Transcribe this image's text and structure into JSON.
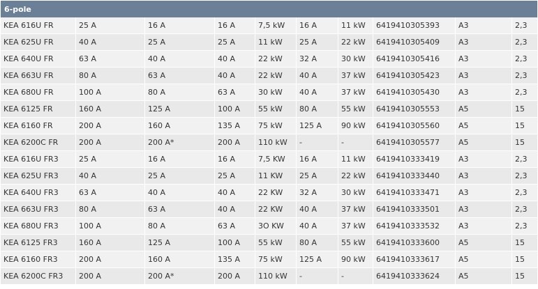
{
  "table": {
    "header": "6-pole",
    "rows": [
      [
        "KEA 616U FR",
        "25 A",
        "16 A",
        "16 A",
        "7,5 kW",
        "16 A",
        "11 kW",
        "6419410305393",
        "A3",
        "2,3"
      ],
      [
        "KEA 625U FR",
        "40 A",
        "25 A",
        "25 A",
        "11 kW",
        "25 A",
        "22 kW",
        "6419410305409",
        "A3",
        "2,3"
      ],
      [
        "KEA 640U FR",
        "63 A",
        "40 A",
        "40 A",
        "22 kW",
        "32 A",
        "30 kW",
        "6419410305416",
        "A3",
        "2,3"
      ],
      [
        "KEA 663U FR",
        "80 A",
        "63 A",
        "40 A",
        "22 kW",
        "40 A",
        "37 kW",
        "6419410305423",
        "A3",
        "2,3"
      ],
      [
        "KEA 680U FR",
        "100 A",
        "80 A",
        "63 A",
        "30 kW",
        "40 A",
        "37 kW",
        "6419410305430",
        "A3",
        "2,3"
      ],
      [
        "KEA 6125 FR",
        "160 A",
        "125 A",
        "100 A",
        "55 kW",
        "80 A",
        "55 kW",
        "6419410305553",
        "A5",
        "15"
      ],
      [
        "KEA 6160 FR",
        "200 A",
        "160 A",
        "135 A",
        "75 kW",
        "125 A",
        "90 kW",
        "6419410305560",
        "A5",
        "15"
      ],
      [
        "KEA 6200C FR",
        "200 A",
        "200 A*",
        "200 A",
        "110 kW",
        "-",
        "-",
        "6419410305577",
        "A5",
        "15"
      ],
      [
        "KEA 616U FR3",
        "25 A",
        "16 A",
        "16 A",
        "7,5 KW",
        "16 A",
        "11 kW",
        "6419410333419",
        "A3",
        "2,3"
      ],
      [
        "KEA 625U FR3",
        "40 A",
        "25 A",
        "25 A",
        "11 KW",
        "25 A",
        "22 kW",
        "6419410333440",
        "A3",
        "2,3"
      ],
      [
        "KEA 640U FR3",
        "63 A",
        "40 A",
        "40 A",
        "22 KW",
        "32 A",
        "30 kW",
        "6419410333471",
        "A3",
        "2,3"
      ],
      [
        "KEA 663U FR3",
        "80 A",
        "63 A",
        "40 A",
        "22 KW",
        "40 A",
        "37 kW",
        "6419410333501",
        "A3",
        "2,3"
      ],
      [
        "KEA 680U FR3",
        "100 A",
        "80 A",
        "63 A",
        "3O KW",
        "40 A",
        "37 kW",
        "6419410333532",
        "A3",
        "2,3"
      ],
      [
        "KEA 6125 FR3",
        "160 A",
        "125 A",
        "100 A",
        "55 kW",
        "80 A",
        "55 kW",
        "6419410333600",
        "A5",
        "15"
      ],
      [
        "KEA 6160 FR3",
        "200 A",
        "160 A",
        "135 A",
        "75 kW",
        "125 A",
        "90 kW",
        "6419410333617",
        "A5",
        "15"
      ],
      [
        "KEA 6200C FR3",
        "200 A",
        "200 A*",
        "200 A",
        "110 kW",
        "-",
        "-",
        "6419410333624",
        "A5",
        "15"
      ]
    ]
  },
  "colors": {
    "header_bg": "#6b7f97",
    "header_text": "#ffffff",
    "row_odd": "#f1f1f1",
    "row_even": "#e9e9e9",
    "text": "#333333"
  }
}
